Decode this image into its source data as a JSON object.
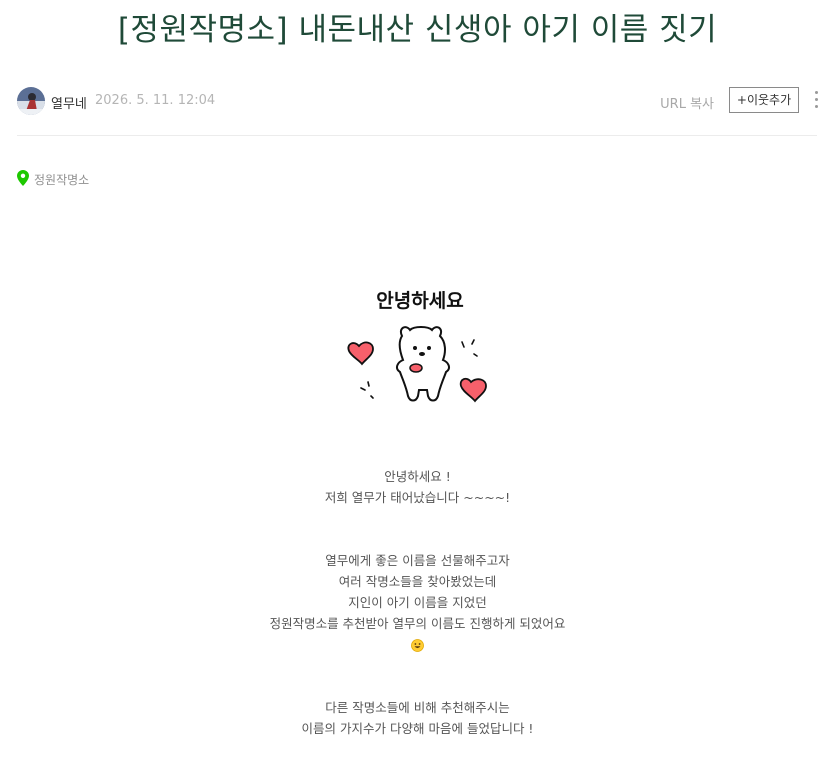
{
  "post": {
    "title": "[정원작명소] 내돈내산 신생아 아기 이름 짓기"
  },
  "meta": {
    "author": "열무네",
    "date": "2026. 5. 11. 12:04",
    "url_copy": "URL 복사",
    "add_neighbor": "+이웃추가"
  },
  "place": {
    "name": "정원작명소"
  },
  "sticker": {
    "text": "안녕하세요",
    "icon": "bear-sticker"
  },
  "paragraphs": [
    {
      "lines": [
        "안녕하세요 !",
        "저희 열무가 태어났습니다 ~~~~!"
      ]
    },
    {
      "lines": [
        "열무에게 좋은 이름을 선물해주고자",
        "여러 작명소들을 찾아봤었는데",
        "지인이 아기 이름을 지었던",
        "정원작명소를 추천받아 열무의 이름도 진행하게 되었어요"
      ],
      "emoji": "grinning-face"
    },
    {
      "lines": [
        "다른 작명소들에 비해 추천해주시는",
        "이름의 가지수가 다양해 마음에 들었답니다 !"
      ]
    }
  ],
  "colors": {
    "title": "#1f4a38",
    "place_pin": "#1ec800",
    "heart": "#f7606b"
  }
}
